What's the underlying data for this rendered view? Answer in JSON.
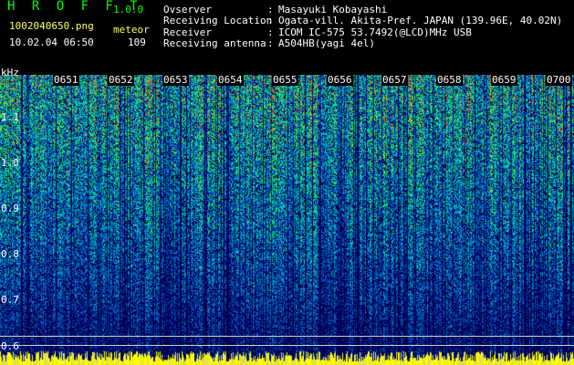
{
  "header": {
    "app_title": "H R O F F T",
    "app_version": "1.0.0",
    "file_name": "1002040650.png",
    "meteor_label": "meteor",
    "date_time": "10.02.04 06:50",
    "meteor_count": "109"
  },
  "info": [
    {
      "label": "Ovserver",
      "value": "Masayuki Kobayashi"
    },
    {
      "label": "Receiving Location",
      "value": "Ogata-vill. Akita-Pref. JAPAN (139.96E, 40.02N)"
    },
    {
      "label": "Receiver",
      "value": "ICOM IC-575 53.7492(@LCD)MHz USB"
    },
    {
      "label": "Receiving antenna",
      "value": "A504HB(yagi 4el)"
    }
  ],
  "axis": {
    "unit": "kHz",
    "freq_labels": [
      "1.1",
      "1.0",
      "0.9",
      "0.8",
      "0.7",
      "0.6"
    ],
    "time_labels": [
      "0651",
      "0652",
      "0653",
      "0654",
      "0655",
      "0656",
      "0657",
      "0658",
      "0659",
      "0700"
    ]
  },
  "colors": {
    "background": "#000060",
    "title": "#00ff00",
    "file_name": "#ffff66",
    "text": "#ffffff"
  }
}
